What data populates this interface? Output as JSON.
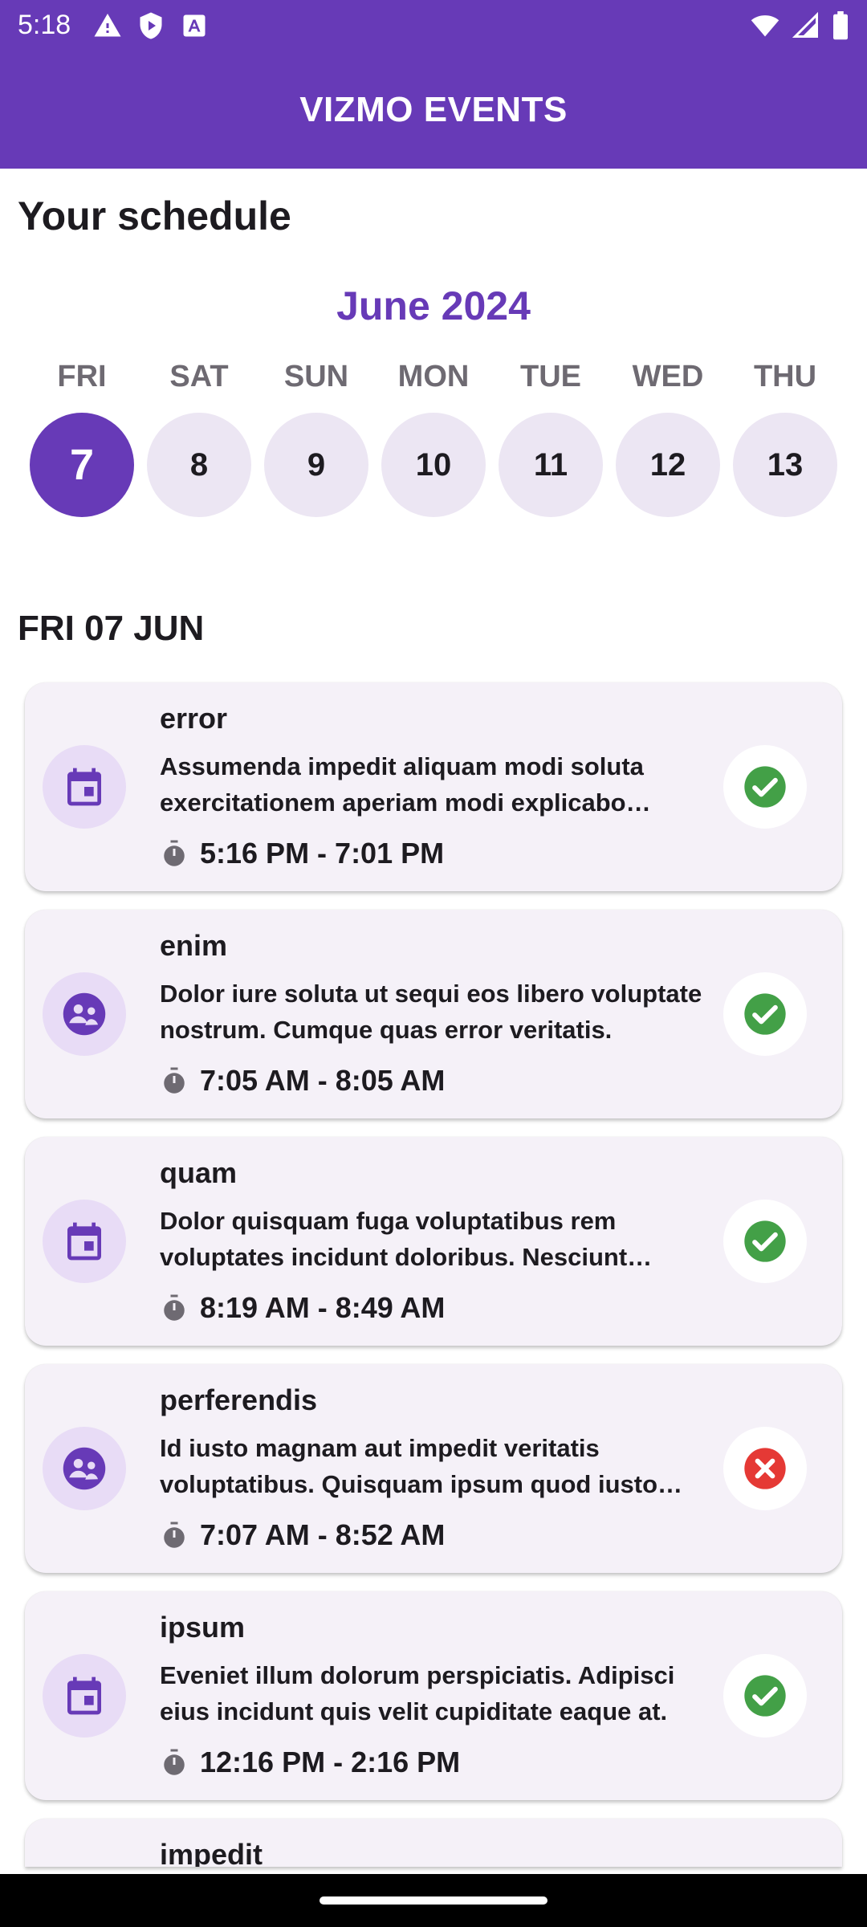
{
  "status_bar": {
    "time": "5:18",
    "icons": [
      "alert-icon",
      "shield-icon",
      "a-badge-icon",
      "wifi-icon",
      "signal-icon",
      "battery-icon"
    ]
  },
  "app_bar": {
    "title": "VIZMO EVENTS",
    "color": "#673ab7"
  },
  "schedule": {
    "title": "Your schedule",
    "month": "June 2024"
  },
  "week": [
    {
      "weekday": "FRI",
      "day": "7",
      "selected": true
    },
    {
      "weekday": "SAT",
      "day": "8",
      "selected": false
    },
    {
      "weekday": "SUN",
      "day": "9",
      "selected": false
    },
    {
      "weekday": "MON",
      "day": "10",
      "selected": false
    },
    {
      "weekday": "TUE",
      "day": "11",
      "selected": false
    },
    {
      "weekday": "WED",
      "day": "12",
      "selected": false
    },
    {
      "weekday": "THU",
      "day": "13",
      "selected": false
    }
  ],
  "date_heading": "FRI 07 JUN",
  "events": [
    {
      "title": "error",
      "icon": "calendar-icon",
      "description": "Assumenda impedit aliquam modi soluta exercitationem aperiam modi explicabo perspiciatis.",
      "time": "5:16 PM - 7:01 PM",
      "status": "accepted"
    },
    {
      "title": "enim",
      "icon": "group-icon",
      "description": "Dolor iure soluta ut sequi eos libero voluptate nostrum. Cumque quas error veritatis.",
      "time": "7:05 AM - 8:05 AM",
      "status": "accepted"
    },
    {
      "title": "quam",
      "icon": "calendar-icon",
      "description": "Dolor quisquam fuga voluptatibus rem voluptates incidunt doloribus. Nesciunt sapiente.",
      "time": "8:19 AM - 8:49 AM",
      "status": "accepted"
    },
    {
      "title": "perferendis",
      "icon": "group-icon",
      "description": "Id iusto magnam aut impedit veritatis voluptatibus. Quisquam ipsum quod iusto eveniet.",
      "time": "7:07 AM - 8:52 AM",
      "status": "declined"
    },
    {
      "title": "ipsum",
      "icon": "calendar-icon",
      "description": "Eveniet illum dolorum perspiciatis. Adipisci eius incidunt quis velit cupiditate eaque at.",
      "time": "12:16 PM - 2:16 PM",
      "status": "accepted"
    }
  ],
  "partial_event": {
    "title": "impedit"
  },
  "colors": {
    "primary": "#673ab7",
    "accepted": "#43a047",
    "declined": "#e53935",
    "card_bg": "#f5f1f8",
    "icon_bg": "#e8dcf6"
  }
}
